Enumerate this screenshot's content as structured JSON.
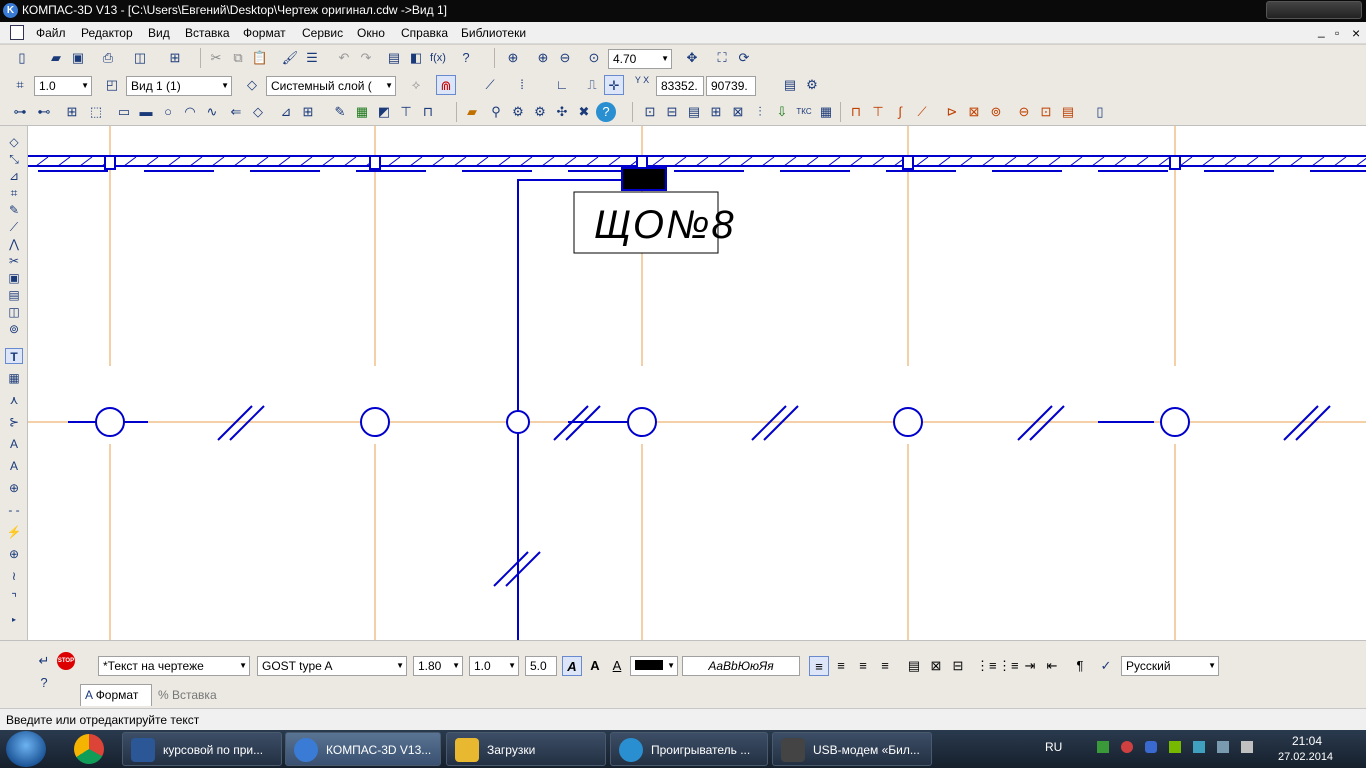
{
  "window": {
    "logo_letter": "K",
    "title": "КОМПАС-3D V13 - [C:\\Users\\Евгений\\Desktop\\Чертеж оригинал.cdw ->Вид 1]"
  },
  "menu": {
    "items": [
      "Файл",
      "Редактор",
      "Вид",
      "Вставка",
      "Формат",
      "Сервис",
      "Окно",
      "Справка",
      "Библиотеки"
    ],
    "right_controls": [
      "_",
      "▫",
      "×"
    ]
  },
  "toolbar1": {
    "zoom_value": "4.70"
  },
  "toolbar2": {
    "step_value": "1.0",
    "view_value": "Вид 1 (1)",
    "layer_value": "Системный слой (",
    "coord_x": "83352.",
    "coord_y": "90739.",
    "xy_label": "Y X"
  },
  "drawing": {
    "label_text": "ЩО№8"
  },
  "propbar": {
    "text_style": "*Текст на чертеже",
    "font": "GOST type A",
    "height": "1.80",
    "narrowing": "1.0",
    "step": "5.0",
    "sample": "АаВbЮюЯя",
    "language": "Русский",
    "stop_label": "STOP",
    "tab_format": "Формат",
    "tab_insert": "Вставка",
    "italic_icon": "italic-a-icon",
    "bold_icon": "bold-a-icon",
    "underline_icon": "underline-a-icon"
  },
  "status": {
    "text": "Введите или отредактируйте текст"
  },
  "taskbar": {
    "items": [
      {
        "label": "курсовой по при...",
        "color": "#2b5797"
      },
      {
        "label": "КОМПАС-3D V13...",
        "color": "#3a7bd5"
      },
      {
        "label": "Загрузки",
        "color": "#e8b830"
      },
      {
        "label": "Проигрыватель ...",
        "color": "#2a8fd0"
      },
      {
        "label": "USB-модем «Бил...",
        "color": "#444444"
      }
    ],
    "lang": "RU",
    "time": "21:04",
    "date": "27.02.2014"
  },
  "colors": {
    "drawing_blue": "#0000cc",
    "grid_orange": "#e8a050",
    "canvas_bg": "#ffffff"
  }
}
